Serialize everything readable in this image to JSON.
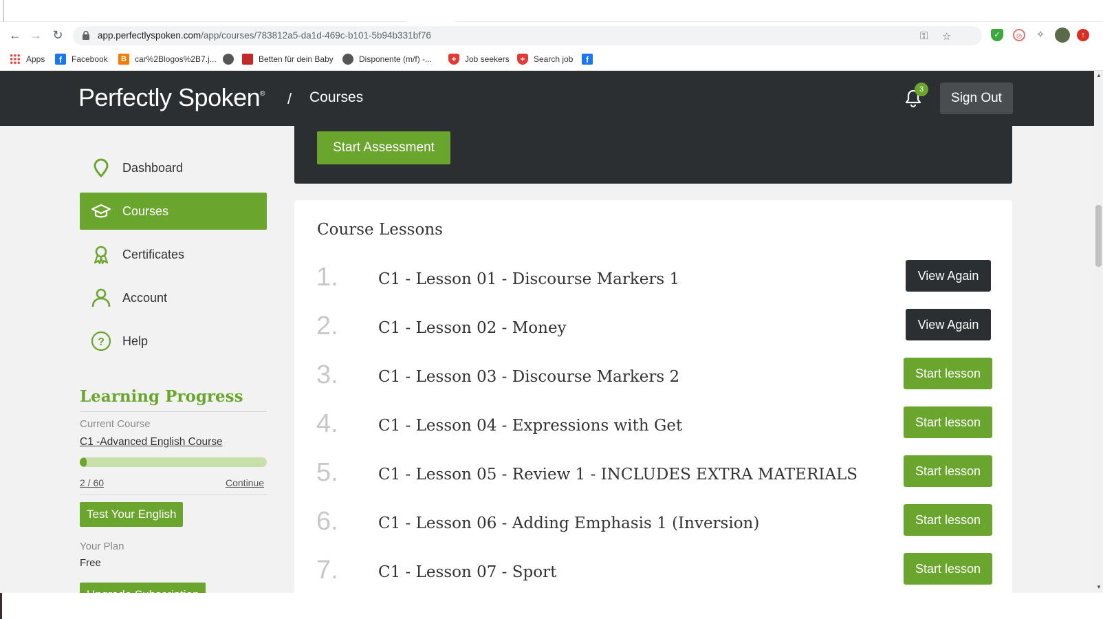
{
  "browser": {
    "url_host": "app.perfectlyspoken.com",
    "url_path": "/app/courses/783812a5-da1d-469c-b101-5b94b331bf76",
    "bookmarks": [
      {
        "label": "Apps",
        "icon": "apps-grid-icon"
      },
      {
        "label": "Facebook",
        "icon": "facebook-icon"
      },
      {
        "label": "car%2Blogos%2B7.j...",
        "icon": "blogger-icon"
      },
      {
        "label": "",
        "icon": "globe-icon"
      },
      {
        "label": "Betten für dein Baby",
        "icon": "baby-bed-icon"
      },
      {
        "label": "Disponente (m/f) -...",
        "icon": "globe-icon"
      },
      {
        "label": "Job seekers",
        "icon": "swiss-cross-icon"
      },
      {
        "label": "Search job",
        "icon": "swiss-cross-icon"
      },
      {
        "label": "",
        "icon": "facebook-icon"
      }
    ]
  },
  "header": {
    "logo": "Perfectly Spoken",
    "logo_mark": "®",
    "breadcrumb_sep": "/",
    "breadcrumb": "Courses",
    "notification_count": "3",
    "sign_out": "Sign Out"
  },
  "sidebar": {
    "items": [
      {
        "label": "Dashboard",
        "icon": "location-pin-icon"
      },
      {
        "label": "Courses",
        "icon": "graduation-cap-icon",
        "active": true
      },
      {
        "label": "Certificates",
        "icon": "award-ribbon-icon"
      },
      {
        "label": "Account",
        "icon": "user-icon"
      },
      {
        "label": "Help",
        "icon": "question-circle-icon"
      }
    ],
    "learning_progress": {
      "title": "Learning Progress",
      "current_course_label": "Current Course",
      "current_course": "C1 -Advanced English Course",
      "progress_fraction": 0.033,
      "count": "2 / 60",
      "continue": "Continue",
      "test_button": "Test Your English",
      "plan_label": "Your Plan",
      "plan": "Free",
      "upgrade_button": "Upgrade Subscription"
    }
  },
  "main": {
    "assessment_button": "Start Assessment",
    "lessons_title": "Course Lessons",
    "lessons": [
      {
        "num": "1.",
        "title": "C1 - Lesson 01 - Discourse Markers 1",
        "action": "View Again",
        "style": "dark"
      },
      {
        "num": "2.",
        "title": "C1 - Lesson 02 - Money",
        "action": "View Again",
        "style": "dark"
      },
      {
        "num": "3.",
        "title": "C1 - Lesson 03 - Discourse Markers 2",
        "action": "Start lesson",
        "style": "green"
      },
      {
        "num": "4.",
        "title": "C1 - Lesson 04 - Expressions with Get",
        "action": "Start lesson",
        "style": "green"
      },
      {
        "num": "5.",
        "title": "C1 - Lesson 05 - Review 1 - INCLUDES EXTRA MATERIALS",
        "action": "Start lesson",
        "style": "green"
      },
      {
        "num": "6.",
        "title": "C1 - Lesson 06 - Adding Emphasis 1 (Inversion)",
        "action": "Start lesson",
        "style": "green"
      },
      {
        "num": "7.",
        "title": "C1 - Lesson 07 - Sport",
        "action": "Start lesson",
        "style": "green"
      }
    ]
  },
  "colors": {
    "brand_green": "#6aa62e",
    "dark": "#2c2f31",
    "page_bg": "#f2f2f2"
  }
}
